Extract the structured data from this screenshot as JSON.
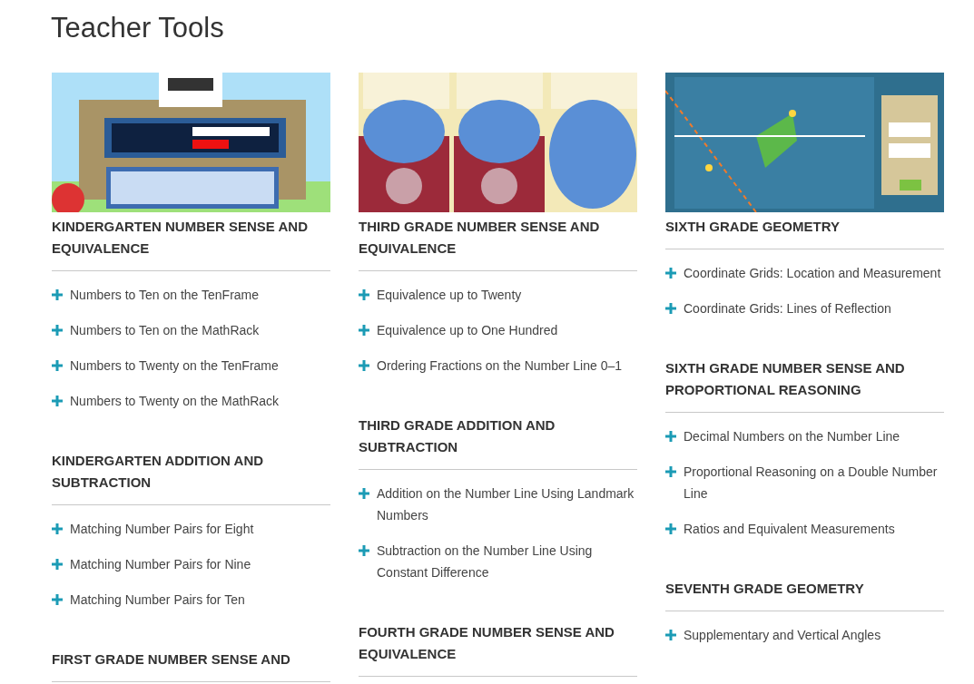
{
  "title": "Teacher Tools",
  "columns": [
    {
      "sections": [
        {
          "heading": "KINDERGARTEN NUMBER SENSE AND EQUIVALENCE",
          "items": [
            "Numbers to Ten on the TenFrame",
            "Numbers to Ten on the MathRack",
            "Numbers to Twenty on the TenFrame",
            "Numbers to Twenty on the MathRack"
          ]
        },
        {
          "heading": "KINDERGARTEN ADDITION AND SUBTRACTION",
          "items": [
            "Matching Number Pairs for Eight",
            "Matching Number Pairs for Nine",
            "Matching Number Pairs for Ten"
          ]
        },
        {
          "heading": "FIRST GRADE NUMBER SENSE AND"
        }
      ]
    },
    {
      "sections": [
        {
          "heading": "THIRD GRADE NUMBER SENSE AND EQUIVALENCE",
          "items": [
            "Equivalence up to Twenty",
            "Equivalence up to One Hundred",
            "Ordering Fractions on the Number Line 0–1"
          ]
        },
        {
          "heading": "THIRD GRADE ADDITION AND SUBTRACTION",
          "items": [
            "Addition on the Number Line Using Landmark Numbers",
            "Subtraction on the Number Line Using Constant Difference"
          ]
        },
        {
          "heading": "FOURTH GRADE NUMBER SENSE AND EQUIVALENCE"
        }
      ]
    },
    {
      "sections": [
        {
          "heading": "SIXTH GRADE GEOMETRY",
          "items": [
            "Coordinate Grids: Location and Measurement",
            "Coordinate Grids: Lines of Reflection"
          ]
        },
        {
          "heading": "SIXTH GRADE NUMBER SENSE AND PROPORTIONAL REASONING",
          "items": [
            "Decimal Numbers on the Number Line",
            "Proportional Reasoning on a Double Number Line",
            "Ratios and Equivalent Measurements"
          ]
        },
        {
          "heading": "SEVENTH GRADE GEOMETRY",
          "items": [
            "Supplementary and Vertical Angles"
          ]
        }
      ]
    }
  ]
}
